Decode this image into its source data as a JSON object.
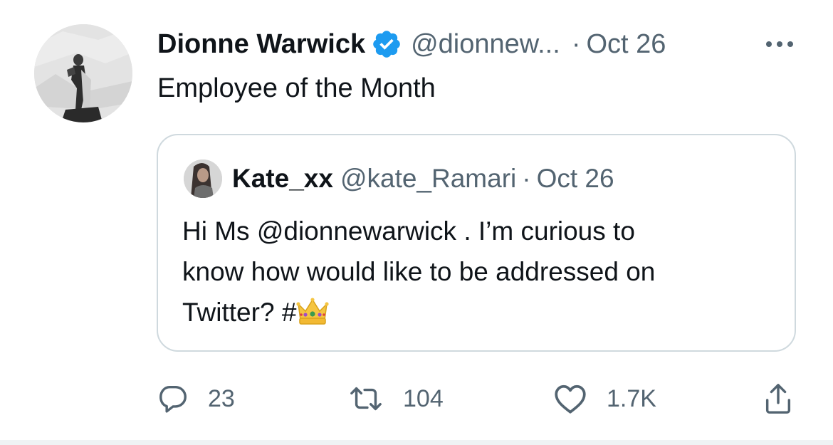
{
  "tweet": {
    "author_name": "Dionne Warwick",
    "author_handle": "@dionnew...",
    "separator": "·",
    "date": "Oct 26",
    "text": "Employee of the Month"
  },
  "quoted": {
    "author_name": "Kate_xx",
    "author_handle": "@kate_Ramari",
    "separator": "·",
    "date": "Oct 26",
    "line1": "Hi Ms @dionnewarwick . I’m curious to",
    "line2": "know how would like to be addressed on",
    "line3": "Twitter? #"
  },
  "actions": {
    "reply_count": "23",
    "retweet_count": "104",
    "like_count": "1.7K"
  },
  "icons": {
    "verified": "verified-badge-icon",
    "more": "more-options-icon",
    "reply": "reply-icon",
    "retweet": "retweet-icon",
    "like": "heart-icon",
    "share": "share-icon",
    "crown": "crown-emoji"
  },
  "colors": {
    "verified_blue": "#1d9bf0",
    "secondary_text": "#536471",
    "border": "#cfd9de"
  }
}
